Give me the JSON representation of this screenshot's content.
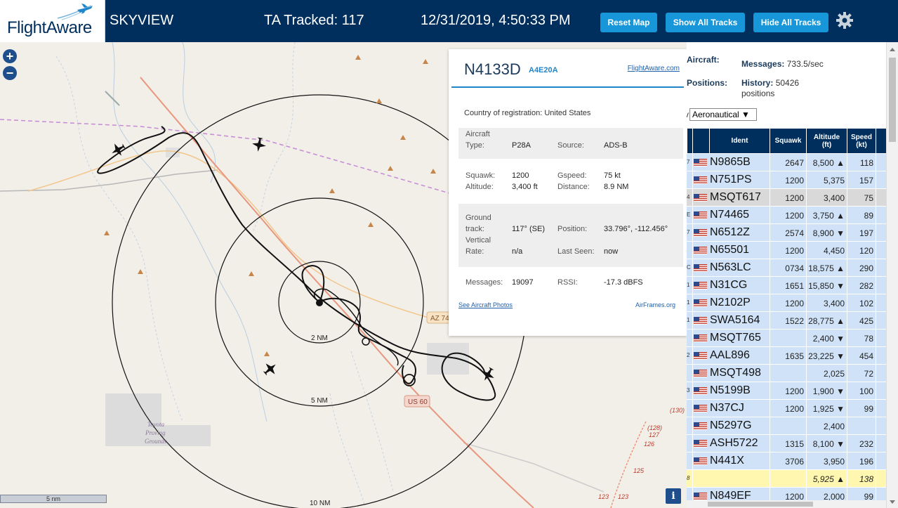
{
  "header": {
    "logo": "FlightAware",
    "title": "SKYVIEW",
    "tracked": "TA Tracked: 117",
    "datetime": "12/31/2019, 4:50:33 PM",
    "buttons": {
      "reset": "Reset Map",
      "show_all": "Show All Tracks",
      "hide_all": "Hide All Tracks"
    },
    "settings_icon": "gear-icon"
  },
  "map": {
    "zoom_in": "+",
    "zoom_out": "−",
    "scale": "5 nm",
    "info": "i",
    "range_rings": [
      "2 NM",
      "5 NM",
      "10 NM"
    ],
    "road_labels": [
      "AZ 74",
      "US 60"
    ],
    "place_label_lines": [
      "Toyota",
      "Proving",
      "Grounds"
    ],
    "highway_numbers": [
      "(130)",
      "(128)",
      "127",
      "126",
      "125",
      "123",
      "123"
    ]
  },
  "popup": {
    "registration": "N4133D",
    "hex": "A4E20A",
    "fa_link": "FlightAware.com",
    "country_label": "Country of registration:",
    "country_value": "United States",
    "aircraft_type_label_1": "Aircraft",
    "aircraft_type_label_2": "Type:",
    "aircraft_type": "P28A",
    "source_label": "Source:",
    "source": "ADS-B",
    "squawk_label": "Squawk:",
    "squawk": "1200",
    "gspeed_label": "Gspeed:",
    "gspeed": "75 kt",
    "altitude_label": "Altitude:",
    "altitude": "3,400 ft",
    "distance_label": "Distance:",
    "distance": "8.9 NM",
    "track_label_1": "Ground",
    "track_label_2": "track:",
    "track": "117° (SE)",
    "position_label": "Position:",
    "position": "33.796°, -112.456°",
    "vrate_label_1": "Vertical",
    "vrate_label_2": "Rate:",
    "vrate": "n/a",
    "lastseen_label": "Last Seen:",
    "lastseen": "now",
    "messages_label": "Messages:",
    "messages": "19097",
    "rssi_label": "RSSI:",
    "rssi": "-17.3 dBFS",
    "photos_link": "See Aircraft Photos",
    "airframes_link": "AirFrames.org"
  },
  "panel": {
    "aircraft_label": "Aircraft:",
    "positions_label": "Positions:",
    "messages_label": "Messages:",
    "messages_value": "733.5/sec",
    "history_label": "History:",
    "history_value_1": "50426",
    "history_value_2": "positions",
    "select_prefix": "v",
    "select_value": "Aeronautical ▼",
    "columns": {
      "ident": "Ident",
      "squawk": "Squawk",
      "altitude_1": "Altitude",
      "altitude_2": "(ft)",
      "speed_1": "Speed",
      "speed_2": "(kt)"
    },
    "rows": [
      {
        "edge": "7",
        "flag": true,
        "ident": "N9865B",
        "squawk": "2647",
        "alt": "8,500 ▲",
        "speed": "118",
        "style": ""
      },
      {
        "edge": "",
        "flag": true,
        "ident": "N751PS",
        "squawk": "1200",
        "alt": "5,375",
        "speed": "157",
        "style": ""
      },
      {
        "edge": "4",
        "flag": true,
        "ident": "MSQT617",
        "squawk": "1200",
        "alt": "3,400",
        "speed": "75",
        "style": "hl"
      },
      {
        "edge": "E",
        "flag": true,
        "ident": "N74465",
        "squawk": "1200",
        "alt": "3,750 ▲",
        "speed": "89",
        "style": ""
      },
      {
        "edge": "7",
        "flag": true,
        "ident": "N6512Z",
        "squawk": "2574",
        "alt": "8,900 ▼",
        "speed": "197",
        "style": ""
      },
      {
        "edge": "",
        "flag": true,
        "ident": "N65501",
        "squawk": "1200",
        "alt": "4,450",
        "speed": "120",
        "style": ""
      },
      {
        "edge": "C",
        "flag": true,
        "ident": "N563LC",
        "squawk": "0734",
        "alt": "18,575 ▲",
        "speed": "290",
        "style": ""
      },
      {
        "edge": "1",
        "flag": true,
        "ident": "N31CG",
        "squawk": "1651",
        "alt": "15,850 ▼",
        "speed": "282",
        "style": ""
      },
      {
        "edge": "1",
        "flag": true,
        "ident": "N2102P",
        "squawk": "1200",
        "alt": "3,400",
        "speed": "102",
        "style": ""
      },
      {
        "edge": "1",
        "flag": true,
        "ident": "SWA5164",
        "squawk": "1522",
        "alt": "28,775 ▲",
        "speed": "425",
        "style": ""
      },
      {
        "edge": "",
        "flag": true,
        "ident": "MSQT765",
        "squawk": "",
        "alt": "2,400 ▼",
        "speed": "78",
        "style": ""
      },
      {
        "edge": "2",
        "flag": true,
        "ident": "AAL896",
        "squawk": "1635",
        "alt": "23,225 ▼",
        "speed": "454",
        "style": ""
      },
      {
        "edge": "",
        "flag": true,
        "ident": "MSQT498",
        "squawk": "",
        "alt": "2,025",
        "speed": "72",
        "style": ""
      },
      {
        "edge": "3",
        "flag": true,
        "ident": "N5199B",
        "squawk": "1200",
        "alt": "1,900 ▼",
        "speed": "100",
        "style": ""
      },
      {
        "edge": "",
        "flag": true,
        "ident": "N37CJ",
        "squawk": "1200",
        "alt": "1,925 ▼",
        "speed": "99",
        "style": ""
      },
      {
        "edge": "",
        "flag": true,
        "ident": "N5297G",
        "squawk": "",
        "alt": "2,400",
        "speed": "",
        "style": ""
      },
      {
        "edge": "",
        "flag": true,
        "ident": "ASH5722",
        "squawk": "1315",
        "alt": "8,100 ▼",
        "speed": "232",
        "style": ""
      },
      {
        "edge": "",
        "flag": true,
        "ident": "N441X",
        "squawk": "3706",
        "alt": "3,950",
        "speed": "196",
        "style": ""
      },
      {
        "edge": "8",
        "flag": false,
        "ident": "",
        "squawk": "",
        "alt": "5,925 ▲",
        "speed": "138",
        "style": "yl"
      },
      {
        "edge": "",
        "flag": true,
        "ident": "N849EF",
        "squawk": "1200",
        "alt": "2,000",
        "speed": "99",
        "style": ""
      }
    ]
  },
  "colors": {
    "header_bg": "#002f5d",
    "button_bg": "#1797d9",
    "row_bg": "#cfe2f7",
    "row_selected": "#d9d9d9",
    "row_highlight": "#fff7b0",
    "track": "#111111",
    "highway": "#e8967e"
  }
}
